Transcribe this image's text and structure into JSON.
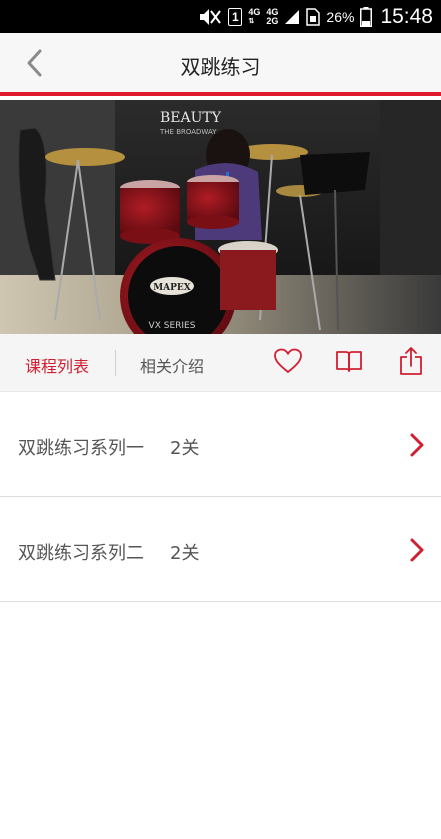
{
  "status_bar": {
    "sim_slot": "1",
    "net_top": "4G",
    "net_bottom_a": "4G",
    "net_bottom_b": "2G",
    "battery_percent": "26%",
    "time": "15:48"
  },
  "header": {
    "title": "双跳练习"
  },
  "tabs": {
    "active_label": "课程列表",
    "inactive_label": "相关介绍"
  },
  "course_list": [
    {
      "name": "双跳练习系列一",
      "count": "2关"
    },
    {
      "name": "双跳练习系列二",
      "count": "2关"
    }
  ],
  "video": {
    "backdrop_text": "BEAUTY",
    "backdrop_subtext": "THE BROADWAY",
    "drum_brand": "MAPEX",
    "drum_model": "VX SERIES"
  },
  "colors": {
    "accent": "#e0182d",
    "active_tab": "#d01f32"
  },
  "icons": {
    "back": "chevron-left-icon",
    "favorite": "heart-icon",
    "notes": "book-icon",
    "share": "share-icon",
    "row_arrow": "chevron-right-icon"
  }
}
